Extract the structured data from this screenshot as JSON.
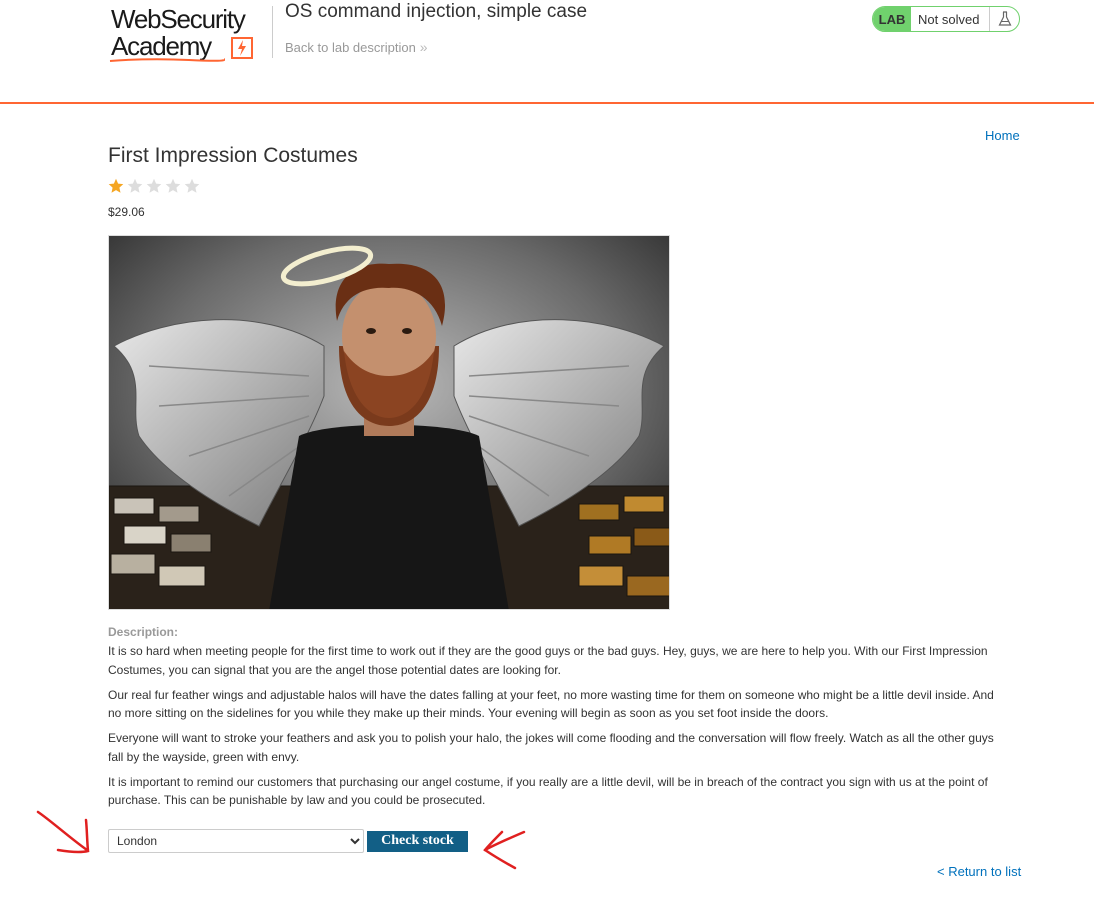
{
  "header": {
    "logo_line1": "WebSecurity",
    "logo_line2": "Academy",
    "lab_title": "OS command injection, simple case",
    "back_link": "Back to lab description",
    "lab_tag": "LAB",
    "lab_status": "Not solved",
    "accent_color": "#ff6633",
    "status_color": "#70d16d"
  },
  "nav": {
    "home": "Home",
    "return": "< Return to list"
  },
  "product": {
    "title": "First Impression Costumes",
    "rating": 1,
    "rating_max": 5,
    "price": "$29.06",
    "description_label": "Description:",
    "paragraphs": [
      "It is so hard when meeting people for the first time to work out if they are the good guys or the bad guys. Hey, guys, we are here to help you. With our First Impression Costumes, you can signal that you are the angel those potential dates are looking for.",
      "Our real fur feather wings and adjustable halos will have the dates falling at your feet, no more wasting time for them on someone who might be a little devil inside. And no more sitting on the sidelines for you while they make up their minds. Your evening will begin as soon as you set foot inside the doors.",
      "Everyone will want to stroke your feathers and ask you to polish your halo, the jokes will come flooding and the conversation will flow freely. Watch as all the other guys fall by the wayside, green with envy.",
      "It is important to remind our customers that purchasing our angel costume, if you really are a little devil, will be in breach of the contract you sign with us at the point of purchase. This can be punishable by law and you could be prosecuted."
    ]
  },
  "stock": {
    "selected_store": "London",
    "button_label": "Check stock"
  },
  "icons": {
    "star_filled": "star-filled-icon",
    "star_empty": "star-empty-icon",
    "flask": "flask-icon",
    "chevron": "double-chevron-right-icon"
  }
}
